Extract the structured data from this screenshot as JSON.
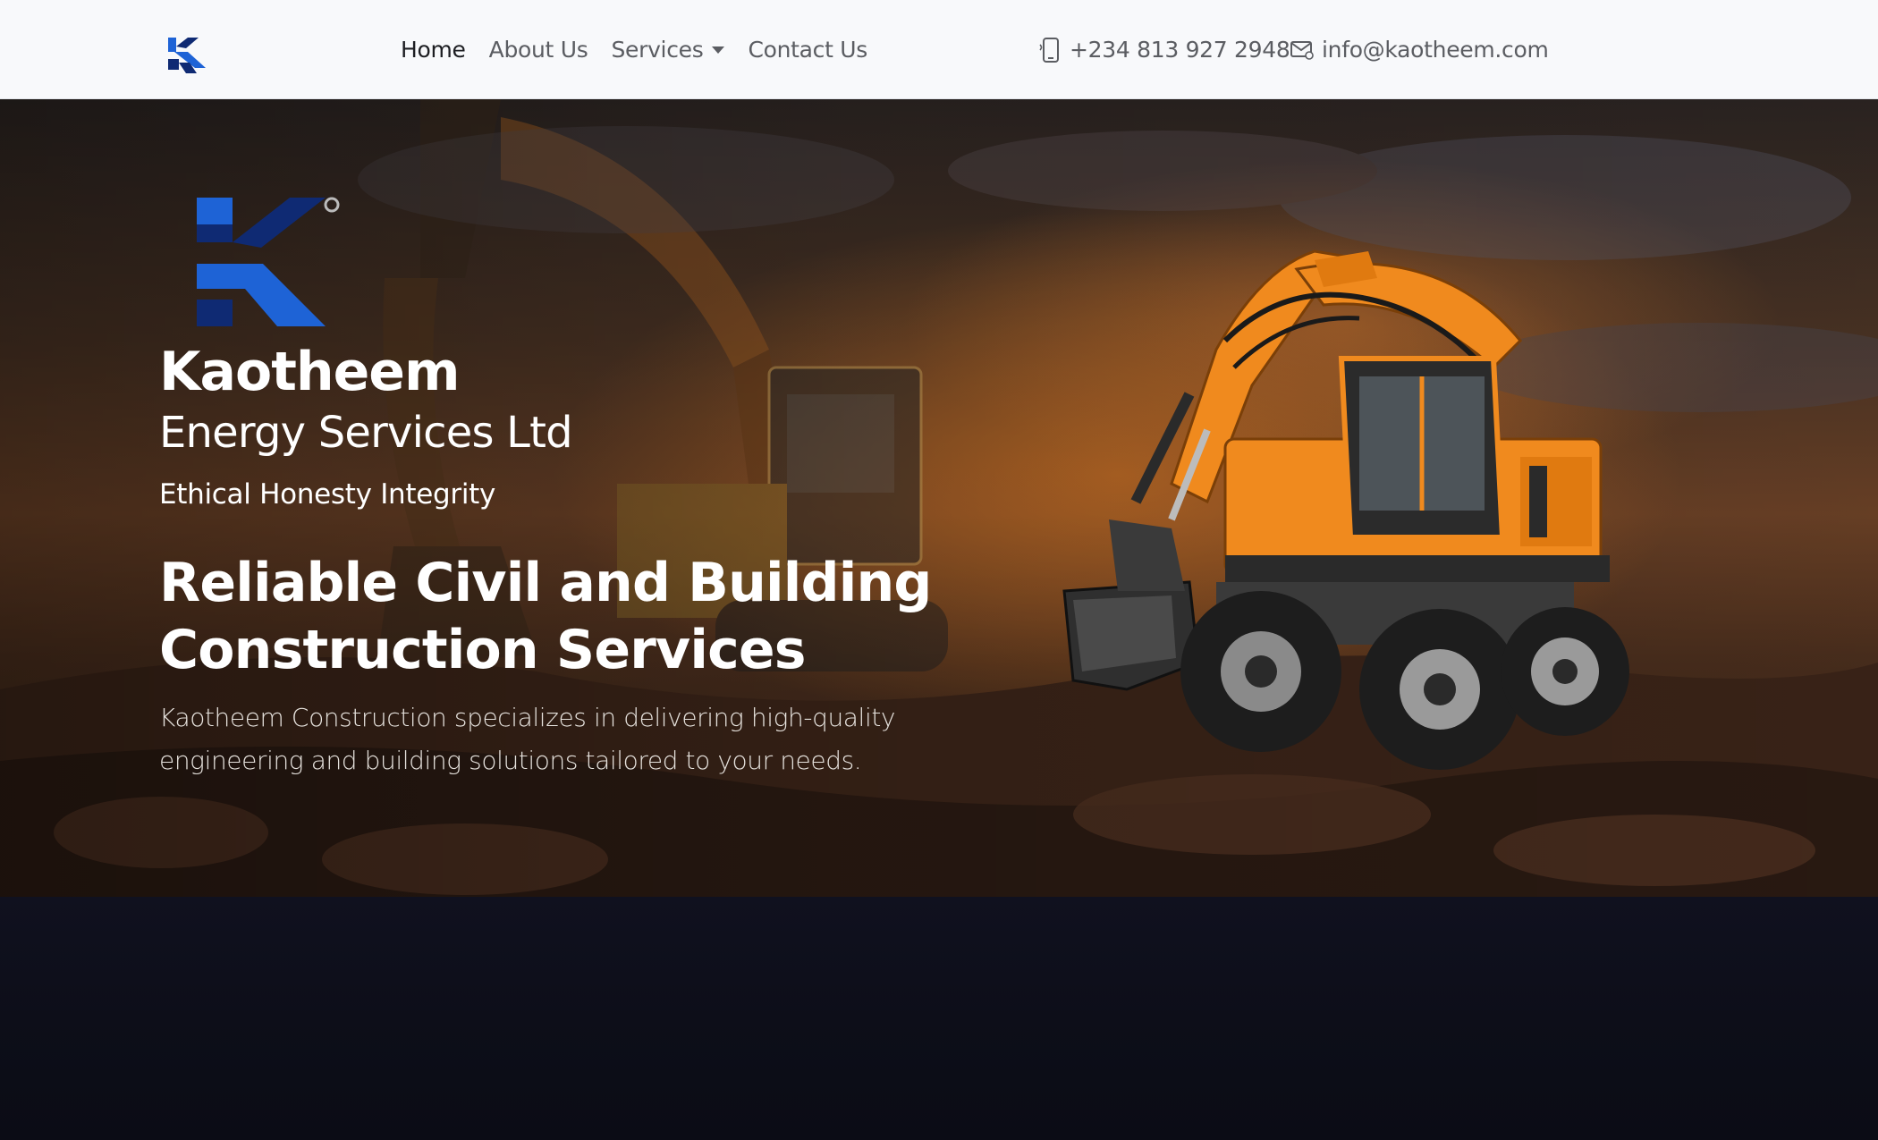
{
  "nav": {
    "brand_name": "Kaotheem",
    "links": [
      {
        "label": "Home",
        "active": true
      },
      {
        "label": "About Us",
        "active": false
      },
      {
        "label": "Services",
        "active": false,
        "dropdown": true
      },
      {
        "label": "Contact Us",
        "active": false
      }
    ],
    "phone": "+234 813 927 2948",
    "email": "info@kaotheem.com",
    "phone_icon": "phone-icon",
    "email_icon": "envelope-icon"
  },
  "hero": {
    "company_name": "Kaotheem",
    "company_sub": "Energy Services Ltd",
    "tagline": "Ethical Honesty Integrity",
    "headline_line1": "Reliable Civil and Building",
    "headline_line2": "Construction Services",
    "lead": "Kaotheem Construction specializes in delivering high-quality engineering and building solutions tailored to your needs.",
    "logo_icon": "kaotheem-logo-icon",
    "image_icon": "excavator-image"
  },
  "colors": {
    "logo_dark": "#0f2a73",
    "logo_blue": "#1e63d6",
    "excavator_orange": "#f08a1e",
    "nav_bg": "#f8f9fb",
    "footer_bg": "#0d0e19"
  }
}
